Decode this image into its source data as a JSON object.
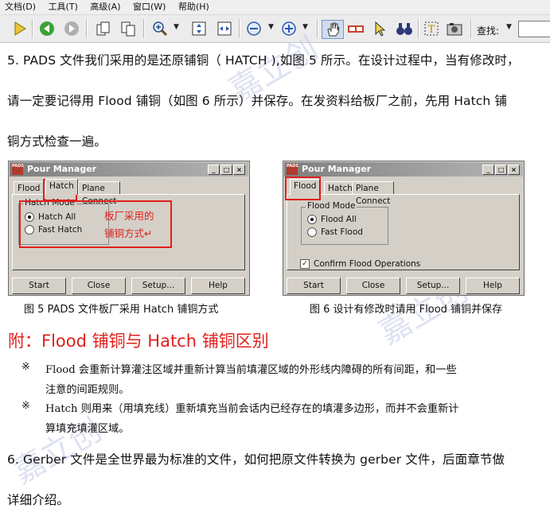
{
  "menu": [
    "文档(D)",
    "工具(T)",
    "高级(A)",
    "窗口(W)",
    "帮助(H)"
  ],
  "toolbar": {
    "find_label": "查找:",
    "icons": [
      "play-icon",
      "back-icon",
      "forward-icon",
      "page-icon",
      "page-icon-2",
      "zoom-in-icon",
      "fit-icon",
      "fit-width-icon",
      "zoom-minus-icon",
      "zoom-plus-icon",
      "hand-icon",
      "glasses-icon",
      "select-icon",
      "binoculars-icon",
      "text-select-icon",
      "snapshot-icon"
    ]
  },
  "paragraphs": {
    "p5_line1": "5. PADS 文件我们采用的是还原铺铜（ HATCH ),如图 5 所示。在设计过程中，当有修改时，",
    "p5_line2": "请一定要记得用 Flood 铺铜（如图 6 所示）并保存。在发资料给板厂之前，先用 Hatch 铺",
    "p5_line3": "铜方式检查一遍。",
    "p6_line1": "6.  Gerber 文件是全世界最为标准的文件，如何把原文件转换为 gerber 文件，后面章节做",
    "p6_line2": "详细介绍。"
  },
  "watermark": "嘉立创",
  "window_left": {
    "title": "Pour Manager",
    "logo": "PADS",
    "tabs": [
      "Flood",
      "Hatch",
      "Plane Connect"
    ],
    "active_tab": "Hatch",
    "group_label": "Hatch Mode",
    "options": [
      "Hatch All",
      "Fast Hatch"
    ],
    "selected": "Hatch All",
    "annotation_line1": "板厂采用的",
    "annotation_line2": "铺铜方式↵",
    "buttons": [
      "Start",
      "Close",
      "Setup...",
      "Help"
    ]
  },
  "window_right": {
    "title": "Pour Manager",
    "logo": "PADS",
    "tabs": [
      "Flood",
      "Hatch",
      "Plane Connect"
    ],
    "active_tab": "Flood",
    "group_label": "Flood Mode",
    "options": [
      "Flood All",
      "Fast Flood"
    ],
    "selected": "Flood All",
    "checkbox": "Confirm Flood Operations",
    "checked": true,
    "buttons": [
      "Start",
      "Close",
      "Setup...",
      "Help"
    ]
  },
  "captions": {
    "fig5": "图 5   PADS 文件板厂采用 Hatch 铺铜方式",
    "fig6": "图 6   设计有修改时请用 Flood 铺铜并保存"
  },
  "appendix": {
    "heading": "附：Flood 铺铜与 Hatch 铺铜区别",
    "bullet": "※",
    "note1_line1": "Flood 会重新计算灌注区域并重新计算当前填灌区域的外形线内障碍的所有间距，和一些",
    "note1_line2": "注意的间距规则。",
    "note2_line1": "Hatch 则用来（用填充线）重新填充当前会话内已经存在的填灌多边形，而并不会重新计",
    "note2_line2": "算填充填灌区域。"
  },
  "colors": {
    "accent_red": "#e0201c",
    "watermark": "#c6cbe8",
    "dialog_bg": "#d4d0c8"
  }
}
